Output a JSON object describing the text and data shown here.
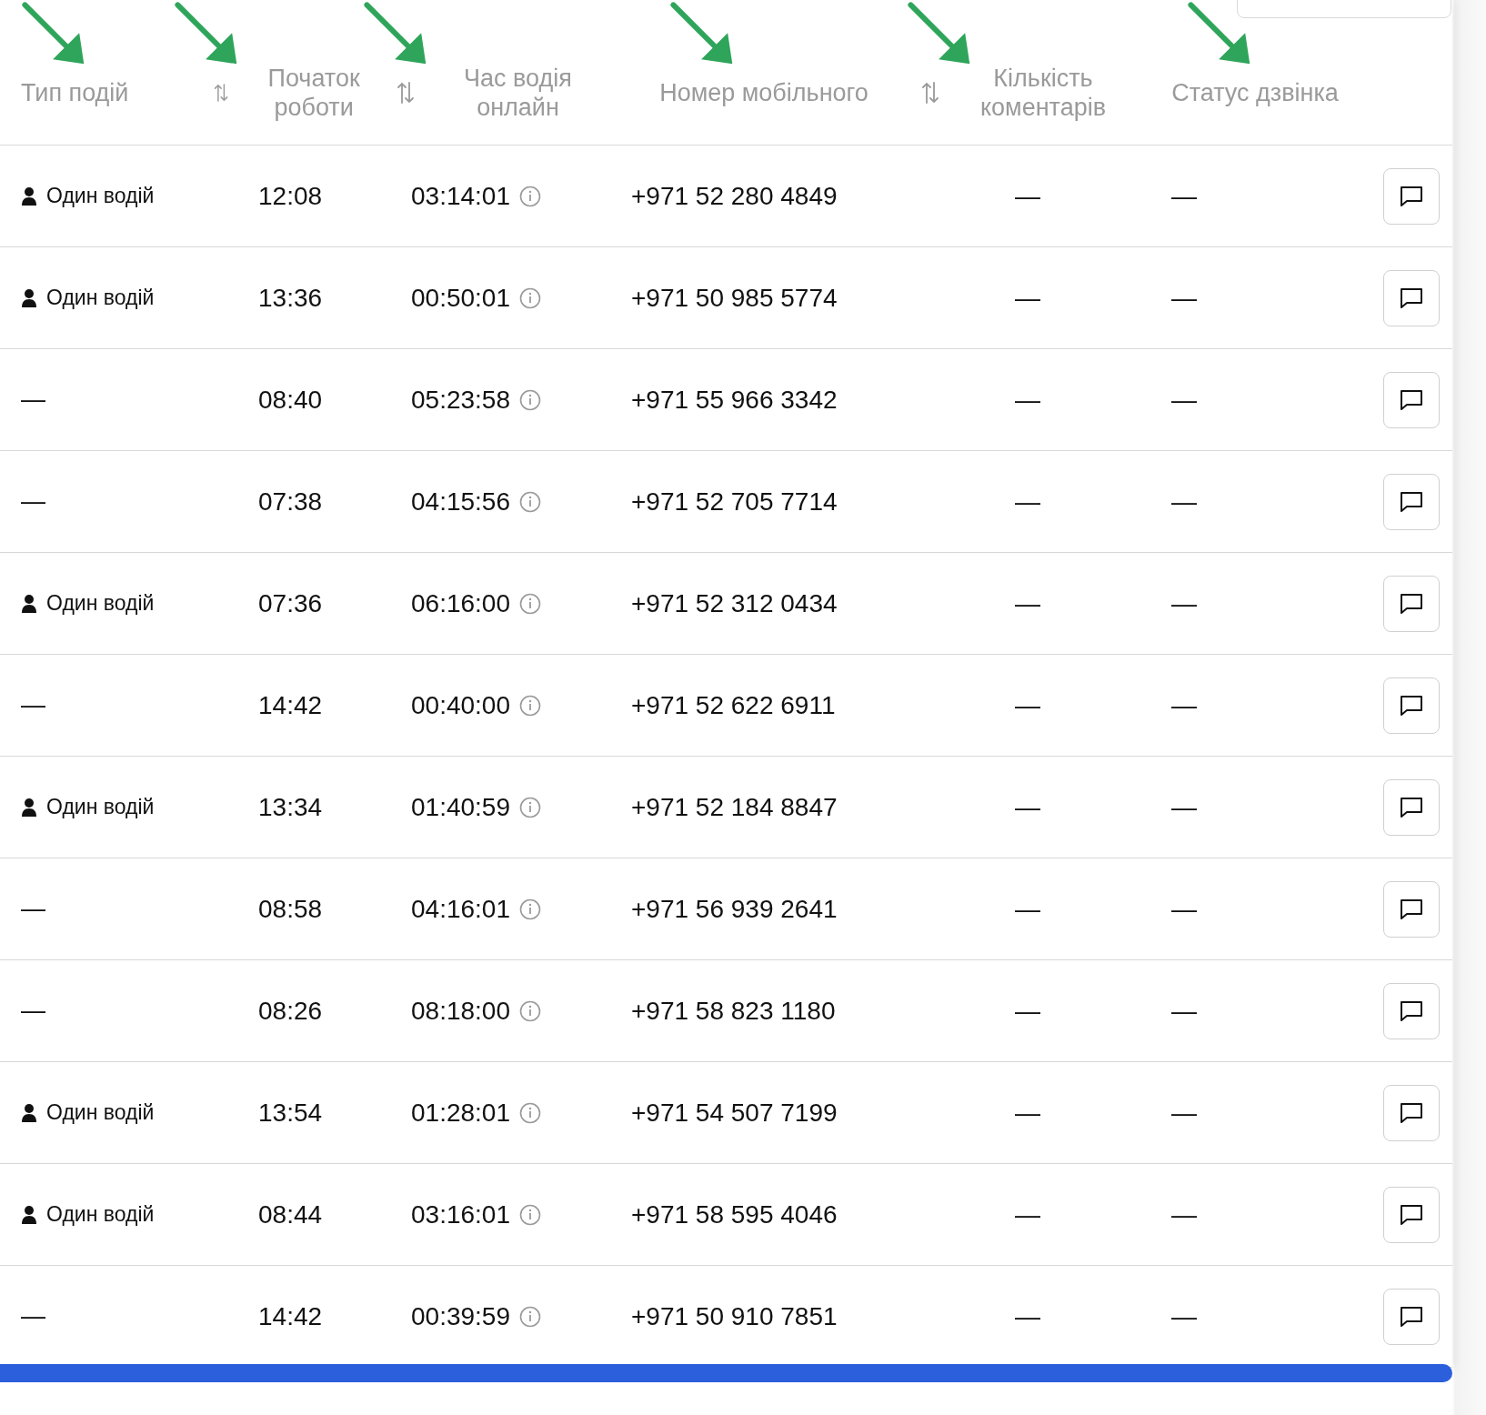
{
  "table": {
    "columns": [
      {
        "label": "Тип подій",
        "sortable": false
      },
      {
        "label": "Початок роботи",
        "sortable": true
      },
      {
        "label": "Час водія онлайн",
        "sortable": true
      },
      {
        "label": "Номер мобільного",
        "sortable": false
      },
      {
        "label": "Кількість коментарів",
        "sortable": true
      },
      {
        "label": "Статус дзвінка",
        "sortable": false
      }
    ],
    "rows": [
      {
        "event": {
          "kind": "driver",
          "text": "Один водій"
        },
        "start": "12:08",
        "online": "03:14:01",
        "phone": "+971 52 280 4849",
        "comments": "—",
        "call_status": "—"
      },
      {
        "event": {
          "kind": "driver",
          "text": "Один водій"
        },
        "start": "13:36",
        "online": "00:50:01",
        "phone": "+971 50 985 5774",
        "comments": "—",
        "call_status": "—"
      },
      {
        "event": {
          "kind": "none",
          "text": "—"
        },
        "start": "08:40",
        "online": "05:23:58",
        "phone": "+971 55 966 3342",
        "comments": "—",
        "call_status": "—"
      },
      {
        "event": {
          "kind": "none",
          "text": "—"
        },
        "start": "07:38",
        "online": "04:15:56",
        "phone": "+971 52 705 7714",
        "comments": "—",
        "call_status": "—"
      },
      {
        "event": {
          "kind": "driver",
          "text": "Один водій"
        },
        "start": "07:36",
        "online": "06:16:00",
        "phone": "+971 52 312 0434",
        "comments": "—",
        "call_status": "—"
      },
      {
        "event": {
          "kind": "none",
          "text": "—"
        },
        "start": "14:42",
        "online": "00:40:00",
        "phone": "+971 52 622 6911",
        "comments": "—",
        "call_status": "—"
      },
      {
        "event": {
          "kind": "driver",
          "text": "Один водій"
        },
        "start": "13:34",
        "online": "01:40:59",
        "phone": "+971 52 184 8847",
        "comments": "—",
        "call_status": "—"
      },
      {
        "event": {
          "kind": "none",
          "text": "—"
        },
        "start": "08:58",
        "online": "04:16:01",
        "phone": "+971 56 939 2641",
        "comments": "—",
        "call_status": "—"
      },
      {
        "event": {
          "kind": "none",
          "text": "—"
        },
        "start": "08:26",
        "online": "08:18:00",
        "phone": "+971 58 823 1180",
        "comments": "—",
        "call_status": "—"
      },
      {
        "event": {
          "kind": "driver",
          "text": "Один водій"
        },
        "start": "13:54",
        "online": "01:28:01",
        "phone": "+971 54 507 7199",
        "comments": "—",
        "call_status": "—"
      },
      {
        "event": {
          "kind": "driver",
          "text": "Один водій"
        },
        "start": "08:44",
        "online": "03:16:01",
        "phone": "+971 58 595 4046",
        "comments": "—",
        "call_status": "—"
      },
      {
        "event": {
          "kind": "none",
          "text": "—"
        },
        "start": "14:42",
        "online": "00:39:59",
        "phone": "+971 50 910 7851",
        "comments": "—",
        "call_status": "—"
      }
    ]
  }
}
